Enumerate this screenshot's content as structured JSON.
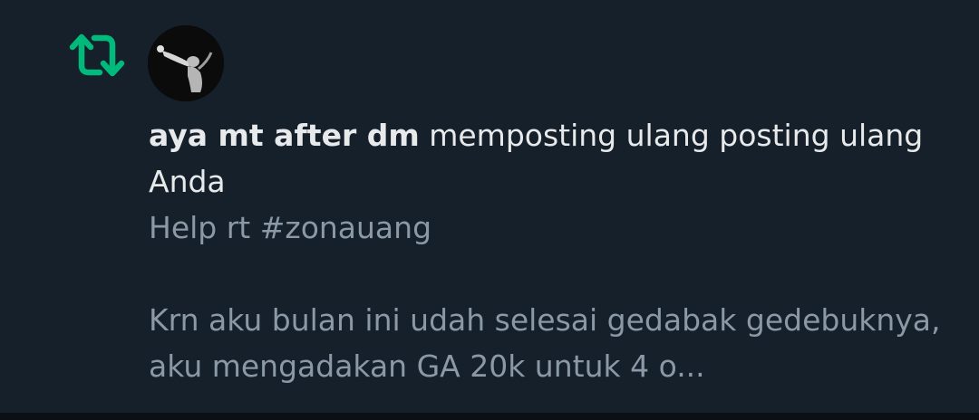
{
  "notification": {
    "type_icon": "repost-icon",
    "avatar_icon": "user-avatar",
    "actor_name": "aya mt after dm",
    "action_text": "memposting ulang posting ulang Anda",
    "preview_line_1": "Help rt #zonauang",
    "preview_line_2": "Krn aku bulan ini udah selesai gedabak gedebuknya, aku mengadakan GA 20k untuk 4 o..."
  },
  "colors": {
    "background": "#15202b",
    "repost_green": "#00ba7c",
    "primary_text": "#e7e9ea",
    "secondary_text": "#8b98a5"
  }
}
